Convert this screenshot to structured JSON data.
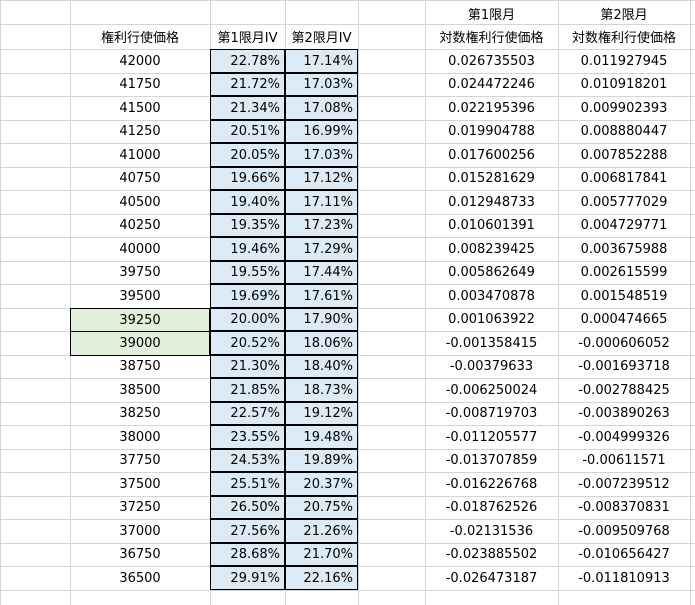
{
  "headers": {
    "strike": "権利行使価格",
    "iv1": "第1限月IV",
    "iv2": "第2限月IV",
    "log1_top": "第1限月",
    "log1_bottom": "対数権利行使価格",
    "log2_top": "第2限月",
    "log2_bottom": "対数権利行使価格"
  },
  "rows": [
    {
      "strike": "42000",
      "iv1": "22.78%",
      "iv2": "17.14%",
      "log1": "0.026735503",
      "log2": "0.011927945"
    },
    {
      "strike": "41750",
      "iv1": "21.72%",
      "iv2": "17.03%",
      "log1": "0.024472246",
      "log2": "0.010918201"
    },
    {
      "strike": "41500",
      "iv1": "21.34%",
      "iv2": "17.08%",
      "log1": "0.022195396",
      "log2": "0.009902393"
    },
    {
      "strike": "41250",
      "iv1": "20.51%",
      "iv2": "16.99%",
      "log1": "0.019904788",
      "log2": "0.008880447"
    },
    {
      "strike": "41000",
      "iv1": "20.05%",
      "iv2": "17.03%",
      "log1": "0.017600256",
      "log2": "0.007852288"
    },
    {
      "strike": "40750",
      "iv1": "19.66%",
      "iv2": "17.12%",
      "log1": "0.015281629",
      "log2": "0.006817841"
    },
    {
      "strike": "40500",
      "iv1": "19.40%",
      "iv2": "17.11%",
      "log1": "0.012948733",
      "log2": "0.005777029"
    },
    {
      "strike": "40250",
      "iv1": "19.35%",
      "iv2": "17.23%",
      "log1": "0.010601391",
      "log2": "0.004729771"
    },
    {
      "strike": "40000",
      "iv1": "19.46%",
      "iv2": "17.29%",
      "log1": "0.008239425",
      "log2": "0.003675988"
    },
    {
      "strike": "39750",
      "iv1": "19.55%",
      "iv2": "17.44%",
      "log1": "0.005862649",
      "log2": "0.002615599"
    },
    {
      "strike": "39500",
      "iv1": "19.69%",
      "iv2": "17.61%",
      "log1": "0.003470878",
      "log2": "0.001548519"
    },
    {
      "strike": "39250",
      "iv1": "20.00%",
      "iv2": "17.90%",
      "log1": "0.001063922",
      "log2": "0.000474665",
      "highlight": true
    },
    {
      "strike": "39000",
      "iv1": "20.52%",
      "iv2": "18.06%",
      "log1": "-0.001358415",
      "log2": "-0.000606052",
      "highlight": true
    },
    {
      "strike": "38750",
      "iv1": "21.30%",
      "iv2": "18.40%",
      "log1": "-0.00379633",
      "log2": "-0.001693718"
    },
    {
      "strike": "38500",
      "iv1": "21.85%",
      "iv2": "18.73%",
      "log1": "-0.006250024",
      "log2": "-0.002788425"
    },
    {
      "strike": "38250",
      "iv1": "22.57%",
      "iv2": "19.12%",
      "log1": "-0.008719703",
      "log2": "-0.003890263"
    },
    {
      "strike": "38000",
      "iv1": "23.55%",
      "iv2": "19.48%",
      "log1": "-0.011205577",
      "log2": "-0.004999326"
    },
    {
      "strike": "37750",
      "iv1": "24.53%",
      "iv2": "19.89%",
      "log1": "-0.013707859",
      "log2": "-0.00611571"
    },
    {
      "strike": "37500",
      "iv1": "25.51%",
      "iv2": "20.37%",
      "log1": "-0.016226768",
      "log2": "-0.007239512"
    },
    {
      "strike": "37250",
      "iv1": "26.50%",
      "iv2": "20.75%",
      "log1": "-0.018762526",
      "log2": "-0.008370831"
    },
    {
      "strike": "37000",
      "iv1": "27.56%",
      "iv2": "21.26%",
      "log1": "-0.02131536",
      "log2": "-0.009509768"
    },
    {
      "strike": "36750",
      "iv1": "28.68%",
      "iv2": "21.70%",
      "log1": "-0.023885502",
      "log2": "-0.010656427"
    },
    {
      "strike": "36500",
      "iv1": "29.91%",
      "iv2": "22.16%",
      "log1": "-0.026473187",
      "log2": "-0.011810913"
    }
  ]
}
